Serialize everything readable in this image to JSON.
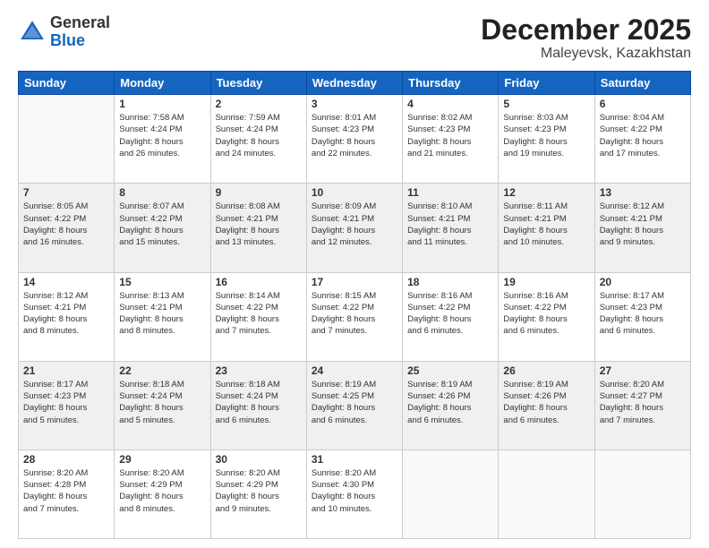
{
  "header": {
    "logo_general": "General",
    "logo_blue": "Blue",
    "month_title": "December 2025",
    "location": "Maleyevsk, Kazakhstan"
  },
  "weekdays": [
    "Sunday",
    "Monday",
    "Tuesday",
    "Wednesday",
    "Thursday",
    "Friday",
    "Saturday"
  ],
  "weeks": [
    [
      {
        "day": "",
        "info": ""
      },
      {
        "day": "1",
        "info": "Sunrise: 7:58 AM\nSunset: 4:24 PM\nDaylight: 8 hours\nand 26 minutes."
      },
      {
        "day": "2",
        "info": "Sunrise: 7:59 AM\nSunset: 4:24 PM\nDaylight: 8 hours\nand 24 minutes."
      },
      {
        "day": "3",
        "info": "Sunrise: 8:01 AM\nSunset: 4:23 PM\nDaylight: 8 hours\nand 22 minutes."
      },
      {
        "day": "4",
        "info": "Sunrise: 8:02 AM\nSunset: 4:23 PM\nDaylight: 8 hours\nand 21 minutes."
      },
      {
        "day": "5",
        "info": "Sunrise: 8:03 AM\nSunset: 4:23 PM\nDaylight: 8 hours\nand 19 minutes."
      },
      {
        "day": "6",
        "info": "Sunrise: 8:04 AM\nSunset: 4:22 PM\nDaylight: 8 hours\nand 17 minutes."
      }
    ],
    [
      {
        "day": "7",
        "info": "Sunrise: 8:05 AM\nSunset: 4:22 PM\nDaylight: 8 hours\nand 16 minutes."
      },
      {
        "day": "8",
        "info": "Sunrise: 8:07 AM\nSunset: 4:22 PM\nDaylight: 8 hours\nand 15 minutes."
      },
      {
        "day": "9",
        "info": "Sunrise: 8:08 AM\nSunset: 4:21 PM\nDaylight: 8 hours\nand 13 minutes."
      },
      {
        "day": "10",
        "info": "Sunrise: 8:09 AM\nSunset: 4:21 PM\nDaylight: 8 hours\nand 12 minutes."
      },
      {
        "day": "11",
        "info": "Sunrise: 8:10 AM\nSunset: 4:21 PM\nDaylight: 8 hours\nand 11 minutes."
      },
      {
        "day": "12",
        "info": "Sunrise: 8:11 AM\nSunset: 4:21 PM\nDaylight: 8 hours\nand 10 minutes."
      },
      {
        "day": "13",
        "info": "Sunrise: 8:12 AM\nSunset: 4:21 PM\nDaylight: 8 hours\nand 9 minutes."
      }
    ],
    [
      {
        "day": "14",
        "info": "Sunrise: 8:12 AM\nSunset: 4:21 PM\nDaylight: 8 hours\nand 8 minutes."
      },
      {
        "day": "15",
        "info": "Sunrise: 8:13 AM\nSunset: 4:21 PM\nDaylight: 8 hours\nand 8 minutes."
      },
      {
        "day": "16",
        "info": "Sunrise: 8:14 AM\nSunset: 4:22 PM\nDaylight: 8 hours\nand 7 minutes."
      },
      {
        "day": "17",
        "info": "Sunrise: 8:15 AM\nSunset: 4:22 PM\nDaylight: 8 hours\nand 7 minutes."
      },
      {
        "day": "18",
        "info": "Sunrise: 8:16 AM\nSunset: 4:22 PM\nDaylight: 8 hours\nand 6 minutes."
      },
      {
        "day": "19",
        "info": "Sunrise: 8:16 AM\nSunset: 4:22 PM\nDaylight: 8 hours\nand 6 minutes."
      },
      {
        "day": "20",
        "info": "Sunrise: 8:17 AM\nSunset: 4:23 PM\nDaylight: 8 hours\nand 6 minutes."
      }
    ],
    [
      {
        "day": "21",
        "info": "Sunrise: 8:17 AM\nSunset: 4:23 PM\nDaylight: 8 hours\nand 5 minutes."
      },
      {
        "day": "22",
        "info": "Sunrise: 8:18 AM\nSunset: 4:24 PM\nDaylight: 8 hours\nand 5 minutes."
      },
      {
        "day": "23",
        "info": "Sunrise: 8:18 AM\nSunset: 4:24 PM\nDaylight: 8 hours\nand 6 minutes."
      },
      {
        "day": "24",
        "info": "Sunrise: 8:19 AM\nSunset: 4:25 PM\nDaylight: 8 hours\nand 6 minutes."
      },
      {
        "day": "25",
        "info": "Sunrise: 8:19 AM\nSunset: 4:26 PM\nDaylight: 8 hours\nand 6 minutes."
      },
      {
        "day": "26",
        "info": "Sunrise: 8:19 AM\nSunset: 4:26 PM\nDaylight: 8 hours\nand 6 minutes."
      },
      {
        "day": "27",
        "info": "Sunrise: 8:20 AM\nSunset: 4:27 PM\nDaylight: 8 hours\nand 7 minutes."
      }
    ],
    [
      {
        "day": "28",
        "info": "Sunrise: 8:20 AM\nSunset: 4:28 PM\nDaylight: 8 hours\nand 7 minutes."
      },
      {
        "day": "29",
        "info": "Sunrise: 8:20 AM\nSunset: 4:29 PM\nDaylight: 8 hours\nand 8 minutes."
      },
      {
        "day": "30",
        "info": "Sunrise: 8:20 AM\nSunset: 4:29 PM\nDaylight: 8 hours\nand 9 minutes."
      },
      {
        "day": "31",
        "info": "Sunrise: 8:20 AM\nSunset: 4:30 PM\nDaylight: 8 hours\nand 10 minutes."
      },
      {
        "day": "",
        "info": ""
      },
      {
        "day": "",
        "info": ""
      },
      {
        "day": "",
        "info": ""
      }
    ]
  ]
}
